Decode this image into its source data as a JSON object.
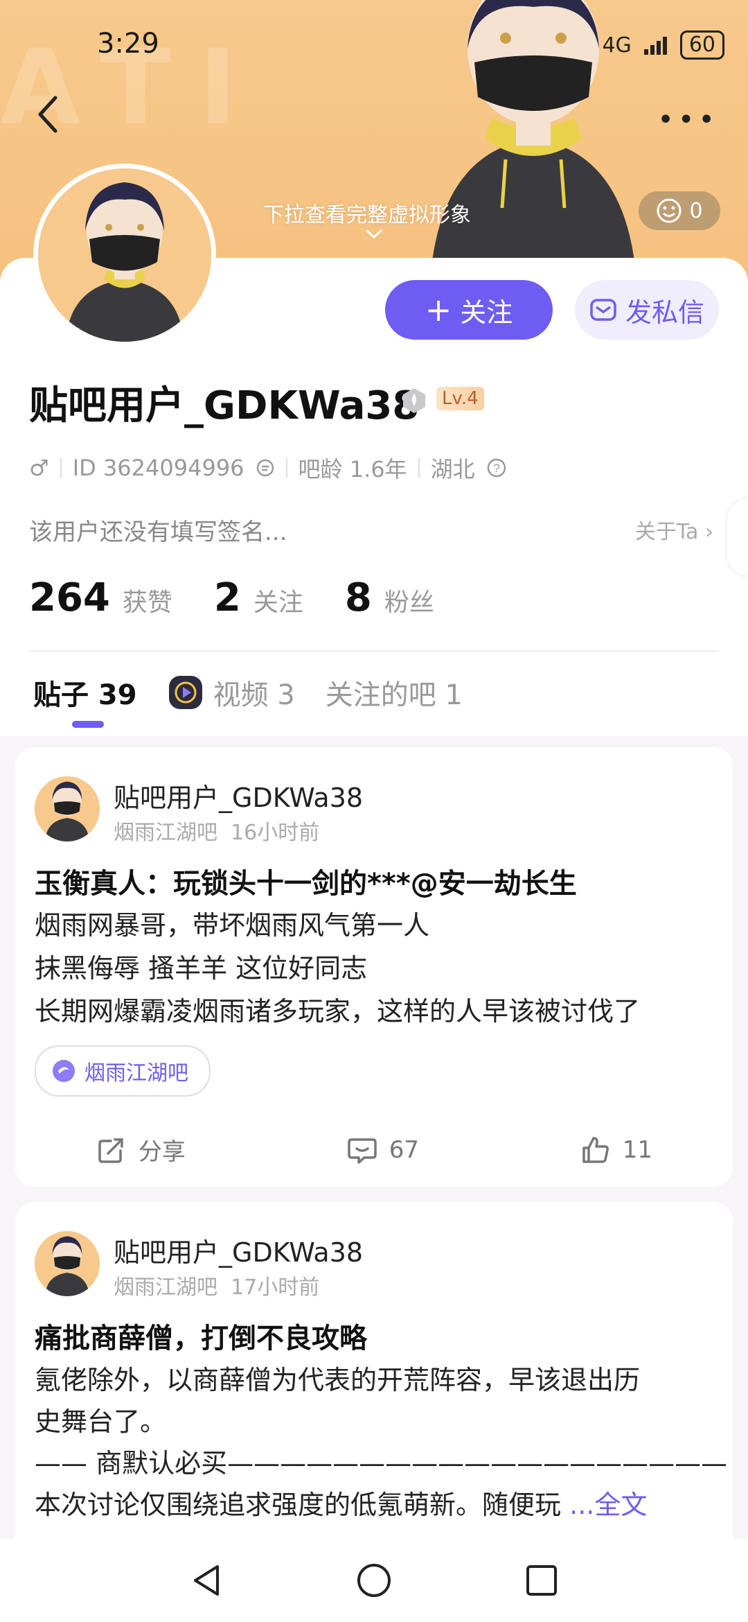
{
  "status_bar": {
    "time": "3:29",
    "network": "4G",
    "battery": "60"
  },
  "hero": {
    "pull_hint": "下拉查看完整虚拟形象",
    "like_count": "0"
  },
  "profile": {
    "follow_label": "关注",
    "dm_label": "发私信",
    "username": "贴吧用户_GDKWa38",
    "level": "Lv.4",
    "gender": "♂",
    "user_id": "ID 3624094996",
    "bar_age": "吧龄 1.6年",
    "location": "湖北",
    "signature": "该用户还没有填写签名...",
    "about_link": "关于Ta",
    "stats": [
      {
        "num": "264",
        "label": "获赞"
      },
      {
        "num": "2",
        "label": "关注"
      },
      {
        "num": "8",
        "label": "粉丝"
      }
    ]
  },
  "tabs": [
    {
      "label": "贴子 39"
    },
    {
      "label": "视频 3"
    },
    {
      "label": "关注的吧 1"
    }
  ],
  "posts": [
    {
      "author": "贴吧用户_GDKWa38",
      "forum": "烟雨江湖吧",
      "time": "16小时前",
      "title": "玉衡真人：玩锁头十一剑的***@安一劫长生",
      "lines": [
        "烟雨网暴哥，带坏烟雨风气第一人",
        "抹黑侮辱 搔羊羊 这位好同志",
        "长期网爆霸凌烟雨诸多玩家，这样的人早该被讨伐了"
      ],
      "chip": "烟雨江湖吧",
      "share": "分享",
      "comments": "67",
      "likes": "11"
    },
    {
      "author": "贴吧用户_GDKWa38",
      "forum": "烟雨江湖吧",
      "time": "17小时前",
      "title": "痛批商薛僧，打倒不良攻略",
      "lines": [
        "氪佬除外，以商薛僧为代表的开荒阵容，早该退出历",
        "史舞台了。",
        "—— 商默认必买———————————————————",
        "本次讨论仅围绕追求强度的低氪萌新。随便玩"
      ],
      "more": "...全文"
    }
  ]
}
